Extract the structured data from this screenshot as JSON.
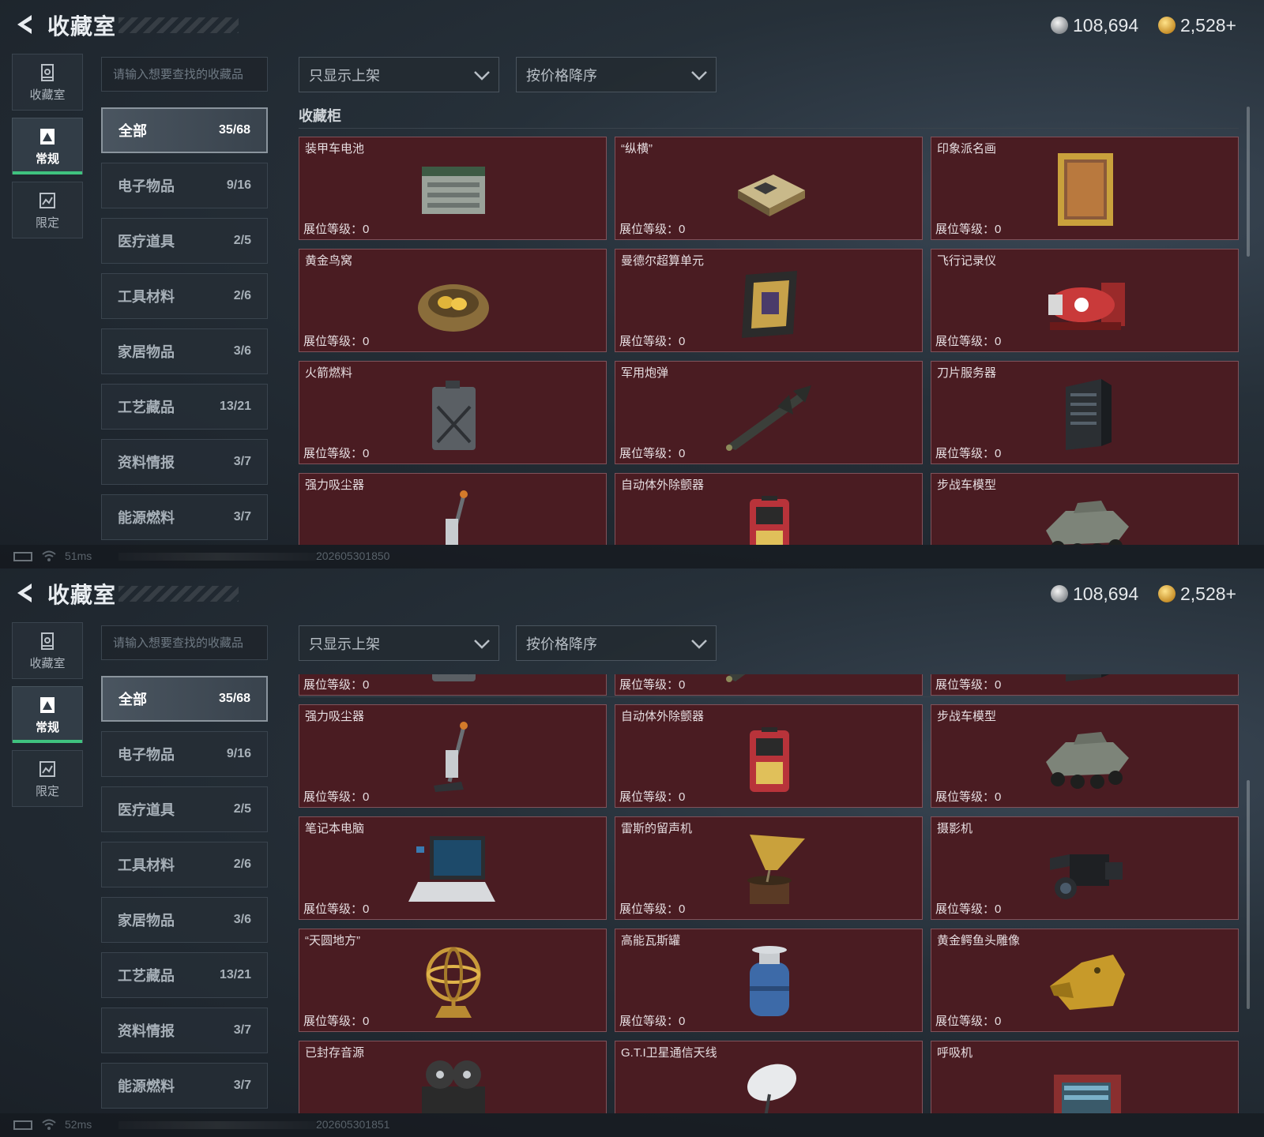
{
  "header": {
    "title": "收藏室",
    "silver": "108,694",
    "gold": "2,528+"
  },
  "rail": [
    {
      "label": "收藏室",
      "icon": "collection-room-icon",
      "active": false
    },
    {
      "label": "常规",
      "icon": "regular-icon",
      "active": true
    },
    {
      "label": "限定",
      "icon": "limited-icon",
      "active": false
    }
  ],
  "search": {
    "placeholder": "请输入想要查找的收藏品"
  },
  "filters": {
    "shelf": "只显示上架",
    "sort": "按价格降序"
  },
  "categories": [
    {
      "label": "全部",
      "count": "35/68",
      "active": true
    },
    {
      "label": "电子物品",
      "count": "9/16"
    },
    {
      "label": "医疗道具",
      "count": "2/5"
    },
    {
      "label": "工具材料",
      "count": "2/6"
    },
    {
      "label": "家居物品",
      "count": "3/6"
    },
    {
      "label": "工艺藏品",
      "count": "13/21"
    },
    {
      "label": "资料情报",
      "count": "3/7"
    },
    {
      "label": "能源燃料",
      "count": "3/7"
    }
  ],
  "section_title": "收藏柜",
  "level_label": "展位等级：",
  "items": [
    {
      "name": "装甲车电池",
      "level": "0",
      "icon": "armored-battery-icon"
    },
    {
      "name": "“纵横”",
      "level": "0",
      "icon": "chessboard-icon"
    },
    {
      "name": "印象派名画",
      "level": "0",
      "icon": "painting-icon"
    },
    {
      "name": "黄金鸟窝",
      "level": "0",
      "icon": "golden-nest-icon"
    },
    {
      "name": "曼德尔超算单元",
      "level": "0",
      "icon": "supercomputer-unit-icon"
    },
    {
      "name": "飞行记录仪",
      "level": "0",
      "icon": "flight-recorder-icon"
    },
    {
      "name": "火箭燃料",
      "level": "0",
      "icon": "fuel-can-icon"
    },
    {
      "name": "军用炮弹",
      "level": "0",
      "icon": "missile-icon"
    },
    {
      "name": "刀片服务器",
      "level": "0",
      "icon": "server-icon"
    },
    {
      "name": "强力吸尘器",
      "level": "0",
      "icon": "vacuum-icon"
    },
    {
      "name": "自动体外除颤器",
      "level": "0",
      "icon": "defibrillator-icon"
    },
    {
      "name": "步战车模型",
      "level": "0",
      "icon": "ifv-model-icon"
    },
    {
      "name": "笔记本电脑",
      "level": "0",
      "icon": "laptop-icon"
    },
    {
      "name": "雷斯的留声机",
      "level": "0",
      "icon": "gramophone-icon"
    },
    {
      "name": "摄影机",
      "level": "0",
      "icon": "camera-icon"
    },
    {
      "name": "“天圆地方”",
      "level": "0",
      "icon": "armillary-sphere-icon"
    },
    {
      "name": "高能瓦斯罐",
      "level": "0",
      "icon": "gas-tank-icon"
    },
    {
      "name": "黄金鳄鱼头雕像",
      "level": "0",
      "icon": "gold-croc-head-icon"
    },
    {
      "name": "已封存音源",
      "level": "0",
      "icon": "tape-recorder-icon"
    },
    {
      "name": "G.T.I卫星通信天线",
      "level": "0",
      "icon": "satellite-dish-icon"
    },
    {
      "name": "呼吸机",
      "level": "0",
      "icon": "ventilator-icon"
    }
  ],
  "screens": [
    {
      "ping": "51ms",
      "build": "202605301850",
      "first_row": 0,
      "row_count": 4
    },
    {
      "ping": "52ms",
      "build": "202605301851",
      "first_row": 2,
      "row_count": 5
    }
  ],
  "colors": {
    "card_bg": "#4a1c22",
    "card_border": "#80525a",
    "accent_green": "#3fc27f"
  }
}
